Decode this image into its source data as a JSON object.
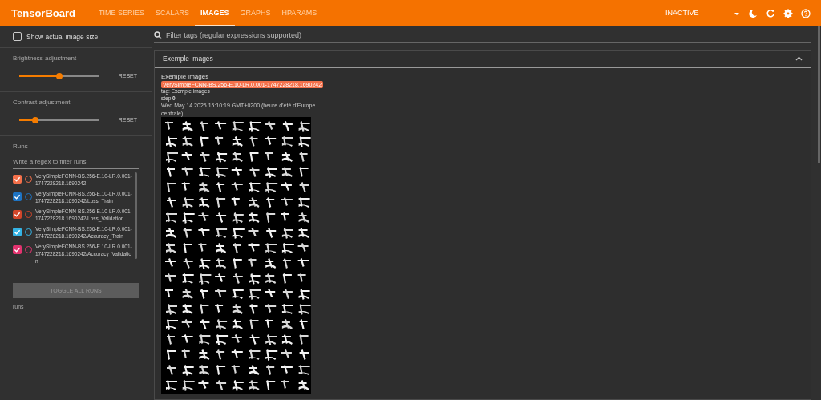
{
  "app": {
    "title": "TensorBoard"
  },
  "tabs": [
    {
      "label": "TIME SERIES",
      "selected": false
    },
    {
      "label": "SCALARS",
      "selected": false
    },
    {
      "label": "IMAGES",
      "selected": true
    },
    {
      "label": "GRAPHS",
      "selected": false
    },
    {
      "label": "HPARAMS",
      "selected": false
    }
  ],
  "plugin_select": {
    "value": "INACTIVE"
  },
  "sidebar": {
    "show_actual_size": {
      "label": "Show actual image size",
      "checked": false
    },
    "sliders": [
      {
        "label": "Brightness adjustment",
        "level": 0.5,
        "button": "RESET"
      },
      {
        "label": "Contrast adjustment",
        "level": 0.2,
        "button": "RESET"
      }
    ],
    "runs": {
      "title": "Runs",
      "filter_placeholder": "Write a regex to filter runs",
      "items": [
        {
          "name": "VerySimpleFCNN-BS.256-E.10-LR.0.001-1747228218.1690242",
          "checked": true,
          "color": "#f4704a"
        },
        {
          "name": "VerySimpleFCNN-BS.256-E.10-LR.0.001-1747228218.1690242/Loss_Train",
          "checked": true,
          "color": "#1e74c4"
        },
        {
          "name": "VerySimpleFCNN-BS.256-E.10-LR.0.001-1747228218.1690242/Loss_Validation",
          "checked": true,
          "color": "#d2462a"
        },
        {
          "name": "VerySimpleFCNN-BS.256-E.10-LR.0.001-1747228218.1690242/Accuracy_Train",
          "checked": true,
          "color": "#35b3e4"
        },
        {
          "name": "VerySimpleFCNN-BS.256-E.10-LR.0.001-1747228218.1690242/Accuracy_Validation",
          "checked": true,
          "color": "#e3336f"
        }
      ],
      "toggle_button": "TOGGLE ALL RUNS",
      "footer": "runs"
    }
  },
  "filter": {
    "placeholder": "Filter tags (regular expressions supported)"
  },
  "card": {
    "title": "Exemple images",
    "expanded": true,
    "image": {
      "title": "Exemple images",
      "run": "VerySimpleFCNN-BS.256-E.10-LR.0.001-1747228218.1690242",
      "tag": "tag: Exemple images",
      "step_label": "step",
      "step": "0",
      "time": "Wed May 14 2025 15:10:19 GMT+0200 (heure d’été d’Europe centrale)"
    }
  }
}
